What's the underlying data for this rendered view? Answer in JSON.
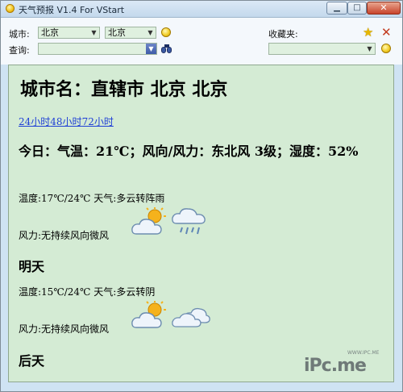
{
  "window": {
    "title": "天气预报 V1.4 For VStart"
  },
  "toolbar": {
    "city_label": "城市:",
    "province_value": "北京",
    "city_value": "北京",
    "query_label": "查询:",
    "query_value": "",
    "favorites_label": "收藏夹:",
    "favorites_value": ""
  },
  "main": {
    "city_title": "城市名：直辖市 北京 北京",
    "links": [
      "24小时",
      "48小时",
      "72小时"
    ],
    "today": "今日：气温：21℃；风向/风力：东北风 3级；湿度：52%",
    "day1": {
      "temp": "温度:17℃/24℃ 天气:多云转阵雨",
      "wind": "风力:无持续风向微风",
      "icons": [
        "partly-cloudy-icon",
        "shower-rain-icon"
      ]
    },
    "day2_heading": "明天",
    "day2": {
      "temp": "温度:15℃/24℃ 天气:多云转阴",
      "wind": "风力:无持续风向微风",
      "icons": [
        "partly-cloudy-icon",
        "cloudy-icon"
      ]
    },
    "day3_heading": "后天"
  },
  "watermark": {
    "logo": "iPc.me",
    "small": "WWW.IPC.ME"
  }
}
